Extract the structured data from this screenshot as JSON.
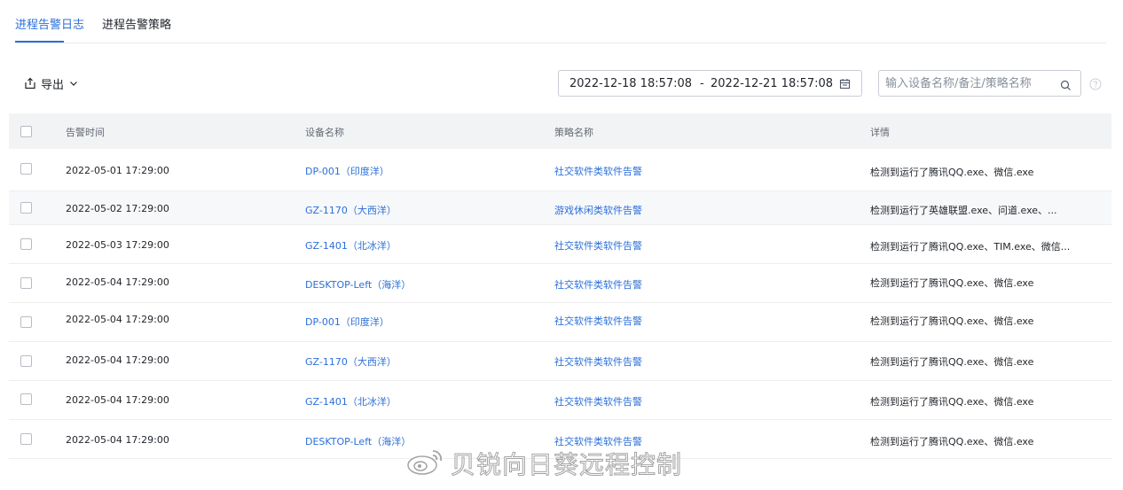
{
  "tabs": [
    {
      "label": "进程告警日志",
      "active": true
    },
    {
      "label": "进程告警策略",
      "active": false
    }
  ],
  "toolbar": {
    "export_label": "导出",
    "date_start": "2022-12-18 18:57:08",
    "date_separator": "-",
    "date_end": "2022-12-21 18:57:08",
    "search_placeholder": "输入设备名称/备注/策略名称"
  },
  "table": {
    "headers": {
      "time": "告警时间",
      "device": "设备名称",
      "policy": "策略名称",
      "detail": "详情"
    },
    "rows": [
      {
        "time": "2022-05-01 17:29:00",
        "device": "DP-001（印度洋）",
        "policy": "社交软件类软件告警",
        "detail": "检测到运行了腾讯QQ.exe、微信.exe"
      },
      {
        "time": "2022-05-02 17:29:00",
        "device": "GZ-1170（大西洋）",
        "policy": "游戏休闲类软件告警",
        "detail": "检测到运行了英雄联盟.exe、问道.exe、..."
      },
      {
        "time": "2022-05-03 17:29:00",
        "device": "GZ-1401（北冰洋）",
        "policy": "社交软件类软件告警",
        "detail": "检测到运行了腾讯QQ.exe、TIM.exe、微信..."
      },
      {
        "time": "2022-05-04 17:29:00",
        "device": "DESKTOP-Left（海洋）",
        "policy": "社交软件类软件告警",
        "detail": "检测到运行了腾讯QQ.exe、微信.exe"
      },
      {
        "time": "2022-05-04 17:29:00",
        "device": "DP-001（印度洋）",
        "policy": "社交软件类软件告警",
        "detail": "检测到运行了腾讯QQ.exe、微信.exe"
      },
      {
        "time": "2022-05-04 17:29:00",
        "device": "GZ-1170（大西洋）",
        "policy": "社交软件类软件告警",
        "detail": "检测到运行了腾讯QQ.exe、微信.exe"
      },
      {
        "time": "2022-05-04 17:29:00",
        "device": "GZ-1401（北冰洋）",
        "policy": "社交软件类软件告警",
        "detail": "检测到运行了腾讯QQ.exe、微信.exe"
      },
      {
        "time": "2022-05-04 17:29:00",
        "device": "DESKTOP-Left（海洋）",
        "policy": "社交软件类软件告警",
        "detail": "检测到运行了腾讯QQ.exe、微信.exe"
      }
    ]
  },
  "watermark": {
    "text": "贝锐向日葵远程控制",
    "icon": "weibo-icon"
  },
  "colors": {
    "accent": "#2b6fd9",
    "header_bg": "#f2f3f5",
    "stripe_bg": "#f7f8fa"
  }
}
